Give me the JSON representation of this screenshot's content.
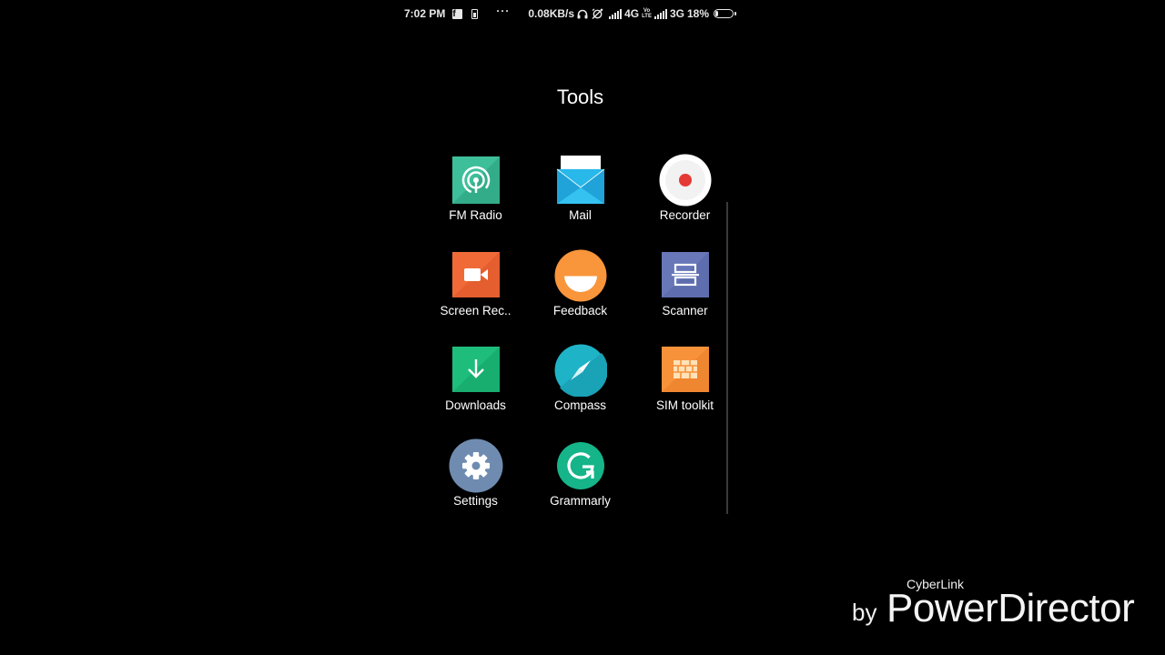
{
  "status_bar": {
    "time": "7:02 PM",
    "overflow": "···",
    "net_speed": "0.08KB/s",
    "sim1_network": "4G",
    "sim2_network": "3G",
    "volte_top": "Vo",
    "volte_bottom": "LTE",
    "battery_percent": "18%",
    "icons": [
      "facebook-icon",
      "clipboard-icon",
      "headphones-icon",
      "alarm-off-icon",
      "signal-icon",
      "signal-icon",
      "battery-icon"
    ]
  },
  "folder": {
    "title": "Tools",
    "apps": [
      {
        "label": "FM Radio",
        "icon": "fm-radio-icon",
        "color": "#3dbf9a"
      },
      {
        "label": "Mail",
        "icon": "mail-icon",
        "color": "#28b8ea"
      },
      {
        "label": "Recorder",
        "icon": "recorder-icon",
        "color": "#e53935"
      },
      {
        "label": "Screen Rec..",
        "icon": "screen-recorder-icon",
        "color": "#f06a38"
      },
      {
        "label": "Feedback",
        "icon": "feedback-icon",
        "color": "#f9953a"
      },
      {
        "label": "Scanner",
        "icon": "scanner-icon",
        "color": "#6777b8"
      },
      {
        "label": "Downloads",
        "icon": "download-icon",
        "color": "#1fbd7c"
      },
      {
        "label": "Compass",
        "icon": "compass-icon",
        "color": "#1fb3c7"
      },
      {
        "label": "SIM toolkit",
        "icon": "sim-card-icon",
        "color": "#f7923a"
      },
      {
        "label": "Settings",
        "icon": "gear-icon",
        "color": "#6f8cb0"
      },
      {
        "label": "Grammarly",
        "icon": "grammarly-icon",
        "color": "#15b489"
      }
    ]
  },
  "watermark": {
    "brand": "CyberLink",
    "by": "by",
    "product": "PowerDirector"
  }
}
